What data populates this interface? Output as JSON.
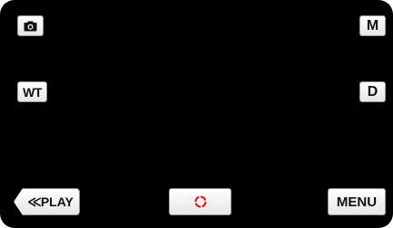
{
  "buttons": {
    "camera": {
      "icon": "camera-icon"
    },
    "manual": {
      "label": "M"
    },
    "zoom": {
      "label": "WT"
    },
    "display": {
      "label": "D"
    },
    "playback": {
      "icon": "double-chevron-left-icon",
      "label": "PLAY"
    },
    "record": {
      "icon": "record-icon",
      "color": "#e8141e"
    },
    "menu": {
      "label": "MENU"
    }
  },
  "colors": {
    "screen_background": "#000000",
    "button_face": "#ffffff",
    "record_accent": "#e8141e"
  }
}
